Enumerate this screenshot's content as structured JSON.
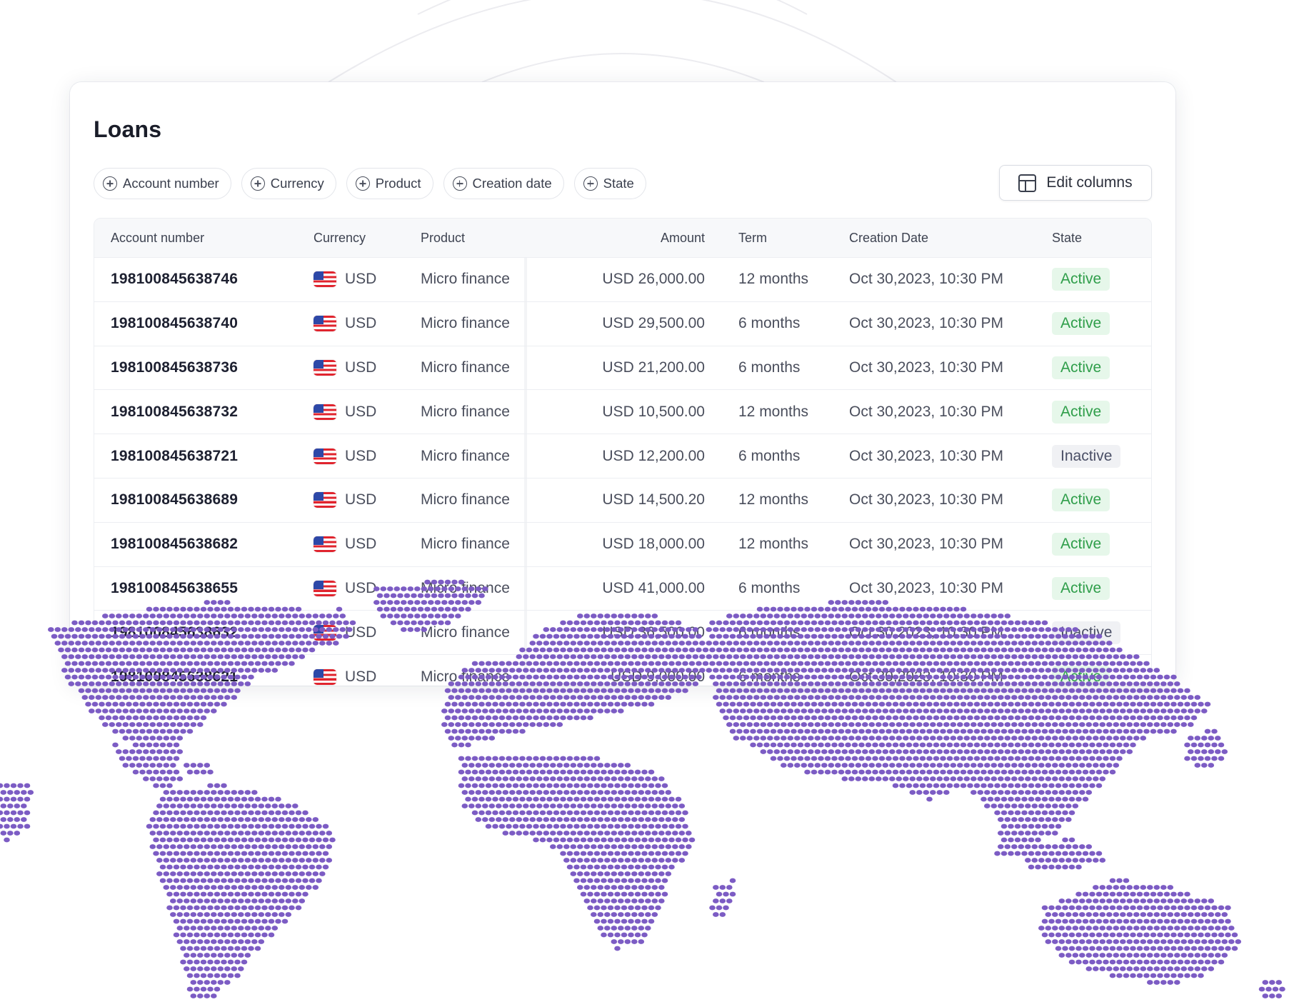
{
  "card": {
    "title": "Loans",
    "filters": [
      {
        "label": "Account number"
      },
      {
        "label": "Currency"
      },
      {
        "label": "Product"
      },
      {
        "label": "Creation date"
      },
      {
        "label": "State"
      }
    ],
    "edit_columns_label": "Edit columns"
  },
  "table": {
    "headers": {
      "account": "Account number",
      "currency": "Currency",
      "product": "Product",
      "amount": "Amount",
      "term": "Term",
      "creation": "Creation Date",
      "state": "State"
    },
    "rows": [
      {
        "account": "198100845638746",
        "currency": "USD",
        "product": "Micro finance",
        "amount": "USD 26,000.00",
        "term": "12 months",
        "creation": "Oct 30,2023, 10:30 PM",
        "state": "Active"
      },
      {
        "account": "198100845638740",
        "currency": "USD",
        "product": "Micro finance",
        "amount": "USD 29,500.00",
        "term": "6 months",
        "creation": "Oct 30,2023, 10:30 PM",
        "state": "Active"
      },
      {
        "account": "198100845638736",
        "currency": "USD",
        "product": "Micro finance",
        "amount": "USD 21,200.00",
        "term": "6 months",
        "creation": "Oct 30,2023, 10:30 PM",
        "state": "Active"
      },
      {
        "account": "198100845638732",
        "currency": "USD",
        "product": "Micro finance",
        "amount": "USD 10,500.00",
        "term": "12 months",
        "creation": "Oct 30,2023, 10:30 PM",
        "state": "Active"
      },
      {
        "account": "198100845638721",
        "currency": "USD",
        "product": "Micro finance",
        "amount": "USD 12,200.00",
        "term": "6 months",
        "creation": "Oct 30,2023, 10:30 PM",
        "state": "Inactive"
      },
      {
        "account": "198100845638689",
        "currency": "USD",
        "product": "Micro finance",
        "amount": "USD 14,500.20",
        "term": "12 months",
        "creation": "Oct 30,2023, 10:30 PM",
        "state": "Active"
      },
      {
        "account": "198100845638682",
        "currency": "USD",
        "product": "Micro finance",
        "amount": "USD 18,000.00",
        "term": "12 months",
        "creation": "Oct 30,2023, 10:30 PM",
        "state": "Active"
      },
      {
        "account": "198100845638655",
        "currency": "USD",
        "product": "Micro finance",
        "amount": "USD 41,000.00",
        "term": "6 months",
        "creation": "Oct 30,2023, 10:30 PM",
        "state": "Active"
      },
      {
        "account": "198100845638632",
        "currency": "USD",
        "product": "Micro finance",
        "amount": "USD 36,500.00",
        "term": "6 months",
        "creation": "Oct 30,2023, 10:30 PM",
        "state": "Inactive"
      },
      {
        "account": "198100845638621",
        "currency": "USD",
        "product": "Micro finance",
        "amount": "USD 9,000.00",
        "term": "6 months",
        "creation": "Oct 30,2023, 10:30 PM",
        "state": "Active"
      }
    ]
  },
  "colors": {
    "map_dot": "#7c5cc4",
    "active_bg": "#e6f7ea",
    "active_text": "#2f9e4a",
    "inactive_bg": "#f0f1f4",
    "inactive_text": "#4a4f66"
  },
  "icons": {
    "filter": "plus-circle-icon",
    "edit_columns": "columns-layout-icon",
    "currency_flag": "us-flag-icon"
  }
}
